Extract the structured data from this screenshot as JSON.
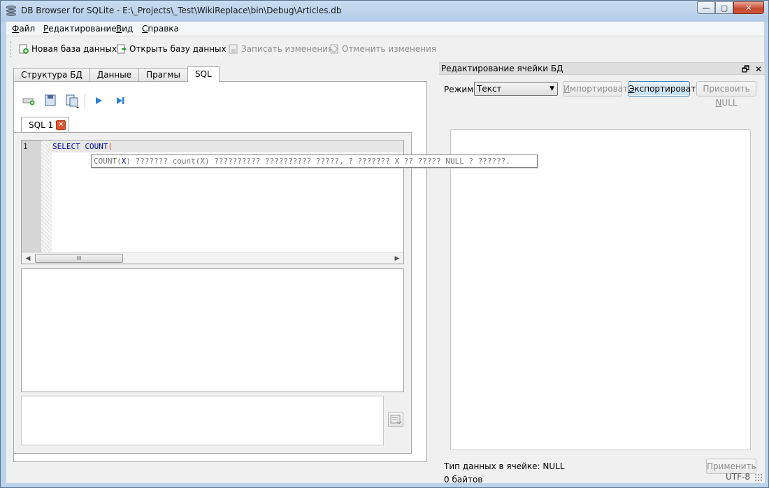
{
  "window": {
    "title": "DB Browser for SQLite - E:\\_Projects\\_Test\\WikiReplace\\bin\\Debug\\Articles.db",
    "controls": {
      "minimize": "—",
      "maximize": "▢",
      "close": "✕"
    }
  },
  "menu": [
    {
      "first": "Ф",
      "rest": "айл"
    },
    {
      "first": "Р",
      "rest": "едактирование"
    },
    {
      "first": "В",
      "rest": "ид"
    },
    {
      "first": "С",
      "rest": "правка"
    }
  ],
  "toolbar": {
    "new_db": "Новая база данных",
    "open_db": "Открыть базу данных",
    "write_changes": "Записать изменения",
    "revert_changes": "Отменить изменения"
  },
  "tabs": {
    "structure": "Структура БД",
    "data": "Данные",
    "pragmas": "Прагмы",
    "sql": "SQL"
  },
  "sql_editor": {
    "tab_label": "SQL 1",
    "line_number": "1",
    "code": {
      "keyword": "SELECT",
      "function": "COUNT",
      "paren": "("
    },
    "scroll_grip": "III",
    "calltip": {
      "fn": "COUNT(",
      "arg": "X",
      "rest": ") ??????? count(X) ?????????? ?????????? ?????, ? ??????? X ?? ????? NULL ? ??????."
    }
  },
  "cell_editor": {
    "title": "Редактирование ячейки БД",
    "mode_label": "Режим:",
    "mode_value": "Текст",
    "import": {
      "pre": "И",
      "rest": "мпортировать"
    },
    "export": {
      "pre": "Э",
      "rest": "кспортировать"
    },
    "set_null": {
      "pre": "Присвоить ",
      "ul": "N",
      "rest": "ULL"
    },
    "data_type": "Тип данных в ячейке: NULL",
    "size": "0 байтов",
    "apply": "Применить"
  },
  "status": {
    "encoding": "UTF-8"
  }
}
